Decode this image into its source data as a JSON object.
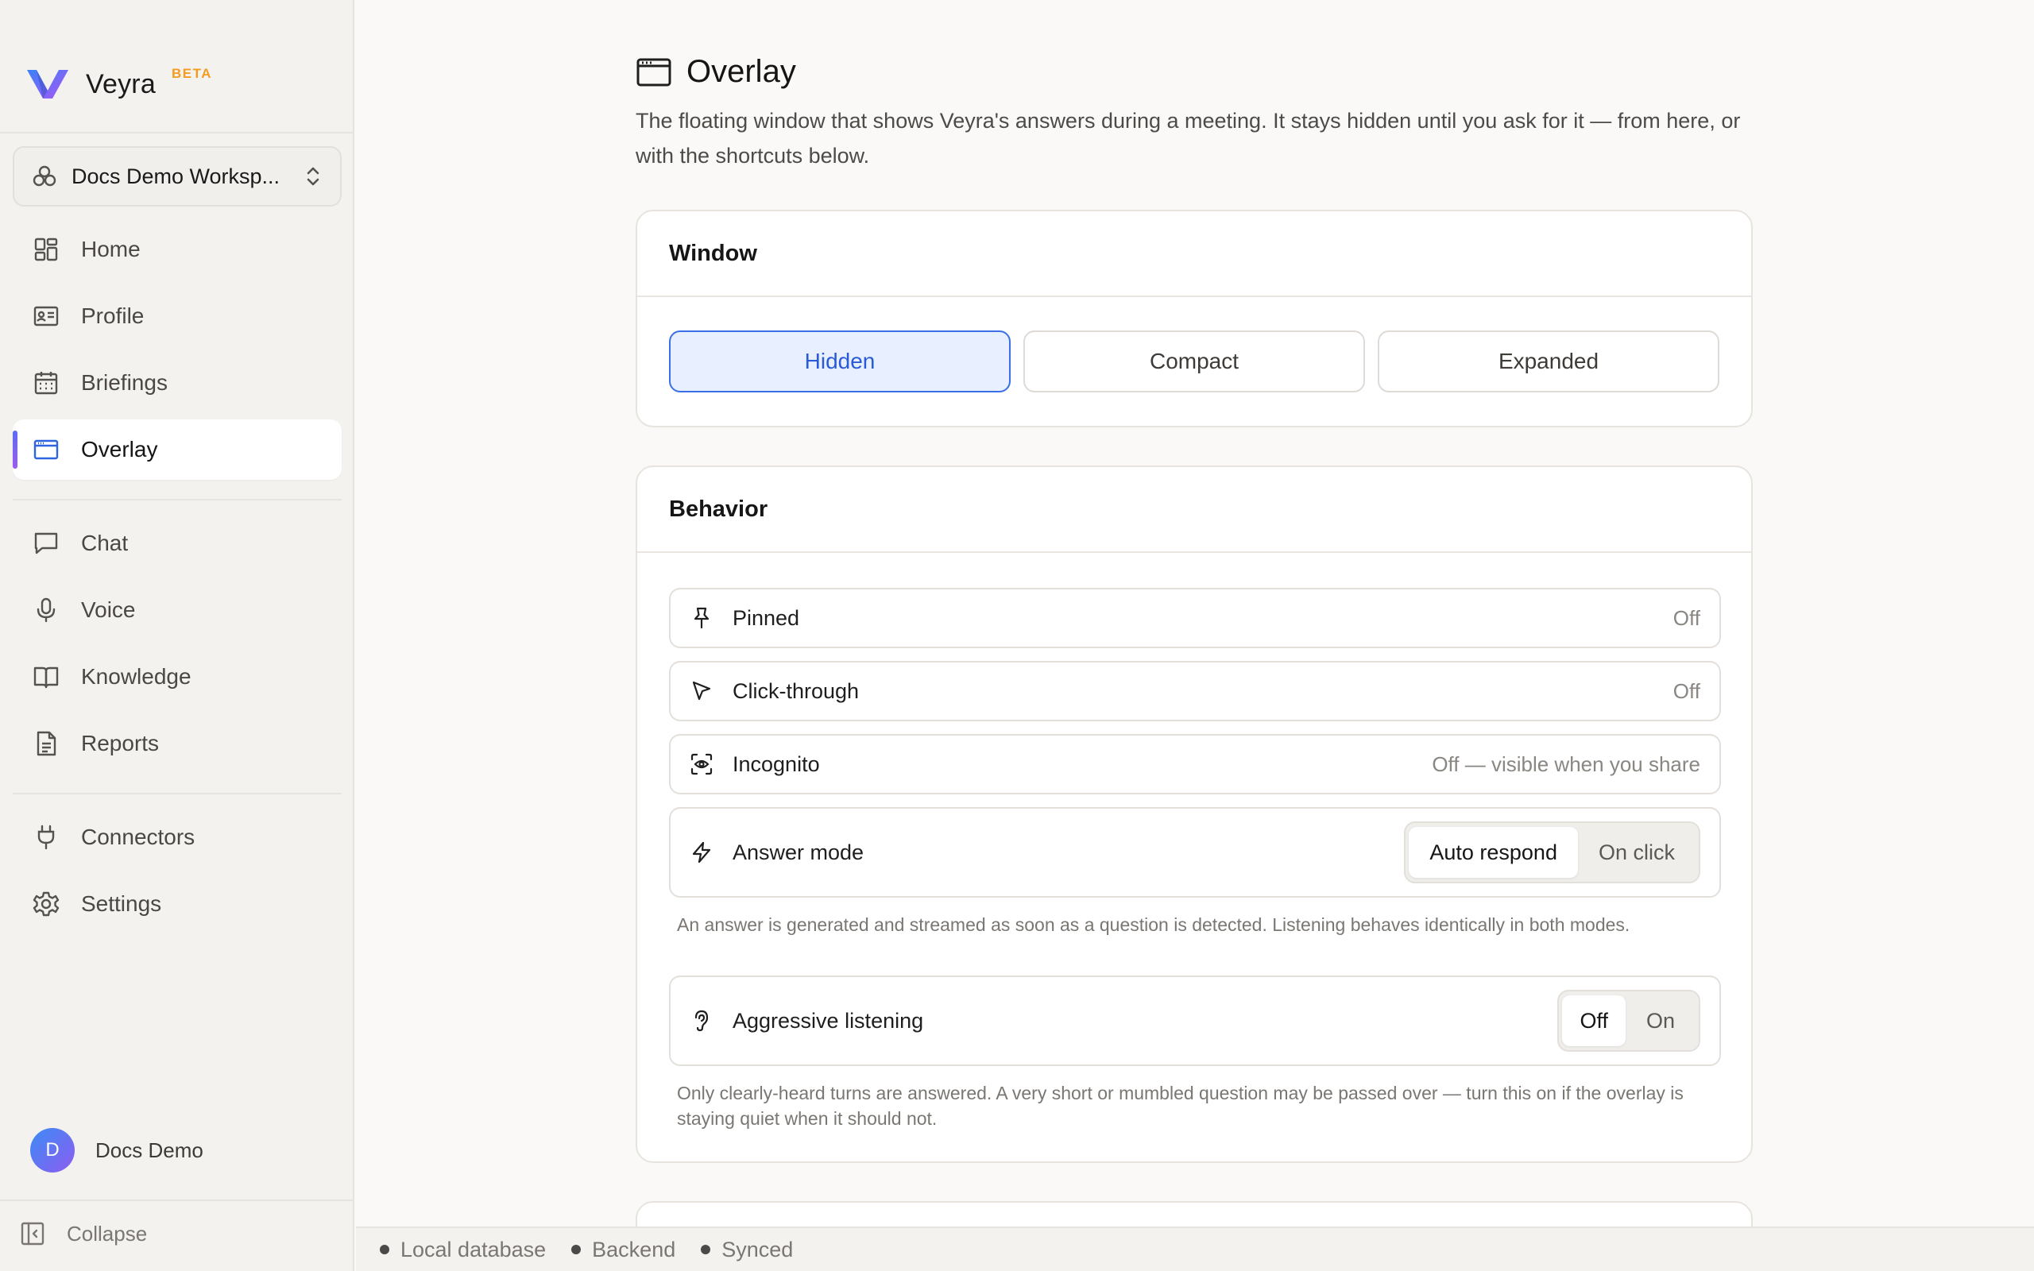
{
  "brand": {
    "name": "Veyra",
    "badge": "BETA"
  },
  "workspace": {
    "name": "Docs Demo Worksp..."
  },
  "nav": {
    "primary": [
      {
        "label": "Home",
        "icon": "grid-icon"
      },
      {
        "label": "Profile",
        "icon": "id-card-icon"
      },
      {
        "label": "Briefings",
        "icon": "calendar-icon"
      },
      {
        "label": "Overlay",
        "icon": "window-icon",
        "active": true
      }
    ],
    "secondary": [
      {
        "label": "Chat",
        "icon": "chat-icon"
      },
      {
        "label": "Voice",
        "icon": "microphone-icon"
      },
      {
        "label": "Knowledge",
        "icon": "book-icon"
      },
      {
        "label": "Reports",
        "icon": "document-icon"
      }
    ],
    "tertiary": [
      {
        "label": "Connectors",
        "icon": "plug-icon"
      },
      {
        "label": "Settings",
        "icon": "gear-icon"
      }
    ]
  },
  "user": {
    "initial": "D",
    "name": "Docs Demo"
  },
  "collapse": {
    "label": "Collapse"
  },
  "page": {
    "title": "Overlay",
    "description": "The floating window that shows Veyra's answers during a meeting. It stays hidden until you ask for it — from here, or with the shortcuts below."
  },
  "window_card": {
    "title": "Window",
    "options": [
      "Hidden",
      "Compact",
      "Expanded"
    ],
    "selected": "Hidden"
  },
  "behavior_card": {
    "title": "Behavior",
    "pinned": {
      "label": "Pinned",
      "value": "Off"
    },
    "click_through": {
      "label": "Click-through",
      "value": "Off"
    },
    "incognito": {
      "label": "Incognito",
      "value": "Off — visible when you share"
    },
    "answer_mode": {
      "label": "Answer mode",
      "options": [
        "Auto respond",
        "On click"
      ],
      "selected": "Auto respond",
      "hint": "An answer is generated and streamed as soon as a question is detected. Listening behaves identically in both modes."
    },
    "aggressive_listening": {
      "label": "Aggressive listening",
      "options": [
        "Off",
        "On"
      ],
      "selected": "Off",
      "hint": "Only clearly-heard turns are answered. A very short or mumbled question may be passed over — turn this on if the overlay is staying quiet when it should not."
    }
  },
  "status": [
    "Local database",
    "Backend",
    "Synced"
  ],
  "colors": {
    "accent": "#3a6fe8",
    "accent_bg": "#e8efff",
    "badge": "#f39c1f",
    "sidebar_bg": "#f4f2ef"
  }
}
